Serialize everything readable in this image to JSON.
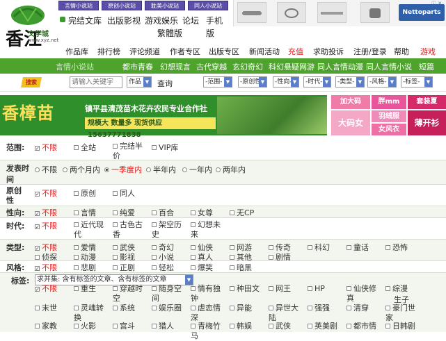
{
  "logo": {
    "site_name": "文学城",
    "domain": "www.xyz.net",
    "brand_char": "香江"
  },
  "top_tabs": [
    "言情小说站",
    "原创小说站",
    "耽美小说站",
    "同人小说站"
  ],
  "site_links": [
    "完结文库",
    "出版影视",
    "游戏娱乐",
    "论坛",
    "手机版",
    "繁體版"
  ],
  "ad": {
    "brand": "Nettoparts",
    "ad_marker": "ⓘ ✕"
  },
  "nav_main": [
    "作品库",
    "排行榜",
    "评论频道",
    "作者专区",
    "出版专区",
    "新闻活动",
    "充值",
    "求助投诉",
    "注册/登录",
    "帮助",
    "游戏"
  ],
  "nav_green": [
    "言情小说站",
    "都市青春",
    "幻想现言",
    "古代穿越",
    "玄幻奇幻",
    "科幻悬疑网游",
    "同人言情动漫",
    "同人言情小说",
    "短篇"
  ],
  "search": {
    "badge": "搜索",
    "placeholder": "请输入关键字",
    "field_select": "作品",
    "button": "查询",
    "selects": [
      "-范围-",
      "-原创性-",
      "-性向-",
      "-时代-",
      "-类型-",
      "-风格-",
      "-标签-"
    ]
  },
  "banner": {
    "title": "香樟苗",
    "subtitle": "镇平县清茂苗木花卉农民专业合作社",
    "strip": "规模大 数量多 现货供应 15637771838",
    "side_ads": [
      "加大码",
      "胖mm",
      "套装夏",
      "大码女",
      "羽绒服",
      "薄开衫",
      "女风衣"
    ]
  },
  "filters": {
    "scope": {
      "label": "范围:",
      "options": [
        "不限",
        "全站",
        "完结半价",
        "VIP库"
      ]
    },
    "time": {
      "label": "发表时间",
      "options": [
        "不限",
        "两个月内",
        "一季度内",
        "半年内",
        "一年内",
        "两年内"
      ]
    },
    "originality": {
      "label": "原创性",
      "options": [
        "不限",
        "原创",
        "同人"
      ]
    },
    "orientation": {
      "label": "性向:",
      "options": [
        "不限",
        "言情",
        "纯爱",
        "百合",
        "女尊",
        "无CP"
      ]
    },
    "era": {
      "label": "时代:",
      "options": [
        "不限",
        "近代现代",
        "古色古香",
        "架空历史",
        "幻想未来"
      ]
    },
    "type": {
      "label": "类型:",
      "options": [
        "不限",
        "爱情",
        "武侠",
        "奇幻",
        "仙侠",
        "网游",
        "传奇",
        "科幻",
        "童话",
        "恐怖",
        "侦探",
        "动漫",
        "影视",
        "小说",
        "真人",
        "其他",
        "剧情"
      ]
    },
    "style": {
      "label": "风格:",
      "options": [
        "不限",
        "悲剧",
        "正剧",
        "轻松",
        "爆笑",
        "暗黑"
      ]
    },
    "tags": {
      "label": "标签:",
      "select": "求并集: 含有标签的文章、含有标签的文章",
      "options": [
        "不限",
        "重生",
        "穿越时空",
        "随身空间",
        "情有独钟",
        "种田文",
        "网王",
        "HP",
        "仙侠修真",
        "综漫",
        "末世",
        "灵魂转换",
        "系统",
        "娱乐圈",
        "虐恋情深",
        "异能",
        "异世大陆",
        "强强",
        "清穿",
        "豪门世家",
        "家教",
        "火影",
        "宫斗",
        "猎人",
        "青梅竹马",
        "韩娱",
        "武侠",
        "英美剧",
        "都市情",
        "日韩剧"
      ],
      "extra": "生子"
    }
  },
  "colors": {
    "nav_green": "#4ea32c",
    "accent_red": "#e02020",
    "tab_purple": "#5a4ea8"
  }
}
